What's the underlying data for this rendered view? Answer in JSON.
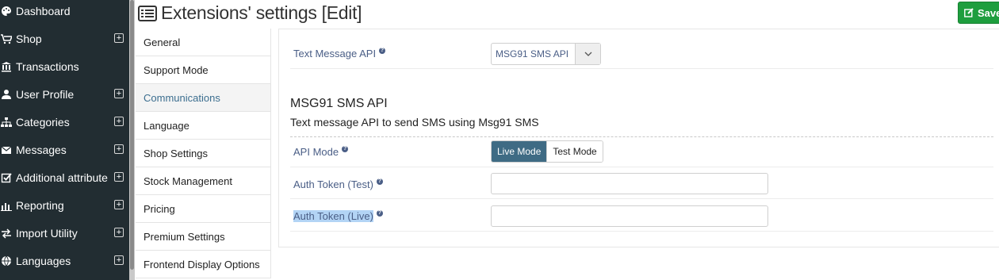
{
  "sidebar": {
    "items": [
      {
        "label": "Dashboard",
        "icon": "palette-icon",
        "expandable": false
      },
      {
        "label": "Shop",
        "icon": "cart-icon",
        "expandable": true
      },
      {
        "label": "Transactions",
        "icon": "bank-icon",
        "expandable": false
      },
      {
        "label": "User Profile",
        "icon": "user-icon",
        "expandable": true
      },
      {
        "label": "Categories",
        "icon": "sitemap-icon",
        "expandable": true
      },
      {
        "label": "Messages",
        "icon": "envelope-icon",
        "expandable": true
      },
      {
        "label": "Additional attribute",
        "icon": "check-square-icon",
        "expandable": true
      },
      {
        "label": "Reporting",
        "icon": "bar-chart-icon",
        "expandable": true
      },
      {
        "label": "Import Utility",
        "icon": "exchange-icon",
        "expandable": true
      },
      {
        "label": "Languages",
        "icon": "globe-icon",
        "expandable": true
      }
    ]
  },
  "header": {
    "title": "Extensions' settings [Edit]",
    "save_label": "Save"
  },
  "nav": {
    "items": [
      {
        "label": "General"
      },
      {
        "label": "Support Mode"
      },
      {
        "label": "Communications"
      },
      {
        "label": "Language"
      },
      {
        "label": "Shop Settings"
      },
      {
        "label": "Stock Management"
      },
      {
        "label": "Pricing"
      },
      {
        "label": "Premium Settings"
      },
      {
        "label": "Frontend Display Options"
      }
    ],
    "active": "Communications"
  },
  "main": {
    "text_message_api_label": "Text Message API",
    "text_message_api_value": "MSG91 SMS API",
    "section_title": "MSG91 SMS API",
    "section_desc": "Text message API to send SMS using Msg91 SMS",
    "api_mode_label": "API Mode",
    "api_mode_options": [
      "Live Mode",
      "Test Mode"
    ],
    "api_mode_selected": "Live Mode",
    "auth_test_label": "Auth Token (Test)",
    "auth_test_value": "",
    "auth_live_label": "Auth Token (Live)",
    "auth_live_value": ""
  },
  "colors": {
    "sidebar_bg": "#222d32",
    "accent": "#3f6b84",
    "save": "#1e9e3e",
    "label": "#4a5e86"
  }
}
